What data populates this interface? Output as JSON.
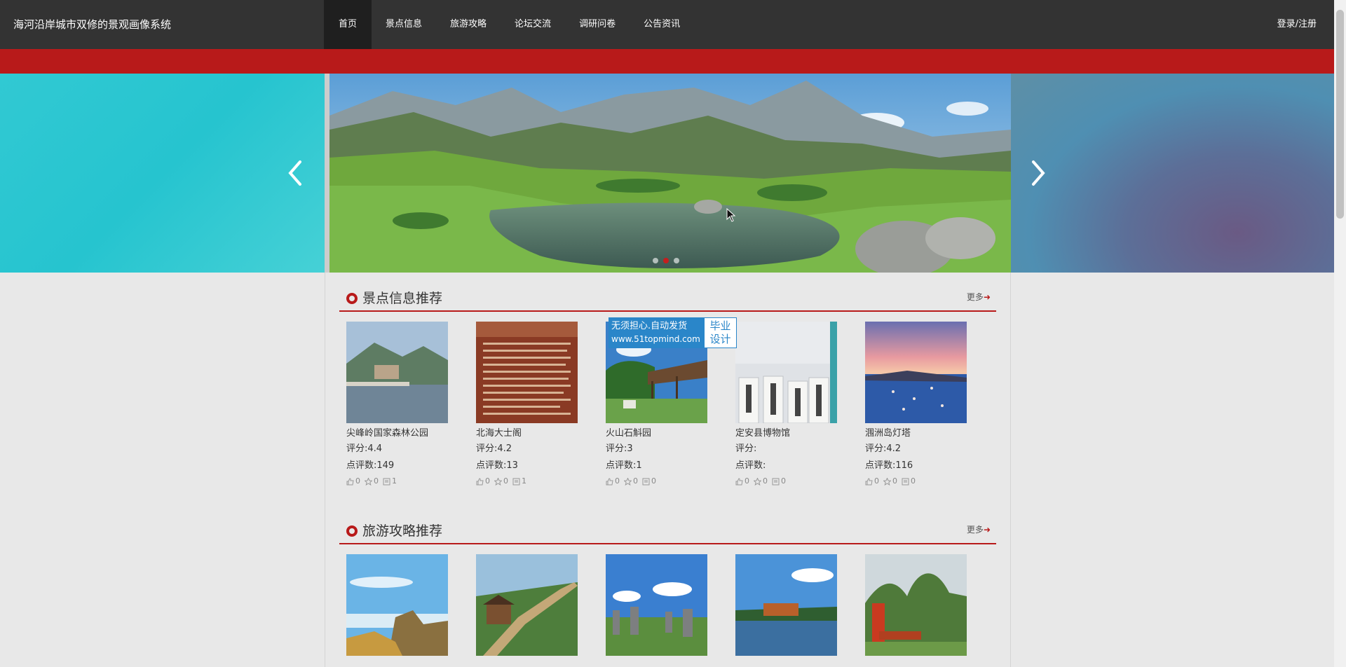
{
  "header": {
    "site_title": "海河沿岸城市双修的景观画像系统",
    "nav": [
      "首页",
      "景点信息",
      "旅游攻略",
      "论坛交流",
      "调研问卷",
      "公告资讯"
    ],
    "active_nav": "首页",
    "login_label": "登录/注册"
  },
  "colors": {
    "accent": "#b81a1a",
    "navbar": "#333333",
    "background": "#e8e8e8"
  },
  "carousel": {
    "slide_count": 3,
    "active_index": 1
  },
  "watermark": {
    "line1": "无须担心.自动发货",
    "line2": "www.51topmind.com",
    "side1": "毕业",
    "side2": "设计"
  },
  "sections": [
    {
      "title": "景点信息推荐",
      "more": "更多",
      "cards": [
        {
          "name": "尖峰岭国家森林公园",
          "rating": "评分:4.4",
          "reviews": "点评数:149",
          "likes": "0",
          "favs": "0",
          "comments": "1"
        },
        {
          "name": "北海大士阁",
          "rating": "评分:4.2",
          "reviews": "点评数:13",
          "likes": "0",
          "favs": "0",
          "comments": "1"
        },
        {
          "name": "火山石斛园",
          "rating": "评分:3",
          "reviews": "点评数:1",
          "likes": "0",
          "favs": "0",
          "comments": "0"
        },
        {
          "name": "定安县博物馆",
          "rating": "评分:",
          "reviews": "点评数:",
          "likes": "0",
          "favs": "0",
          "comments": "0"
        },
        {
          "name": "涠洲岛灯塔",
          "rating": "评分:4.2",
          "reviews": "点评数:116",
          "likes": "0",
          "favs": "0",
          "comments": "0"
        }
      ]
    },
    {
      "title": "旅游攻略推荐",
      "more": "更多",
      "cards": []
    }
  ]
}
